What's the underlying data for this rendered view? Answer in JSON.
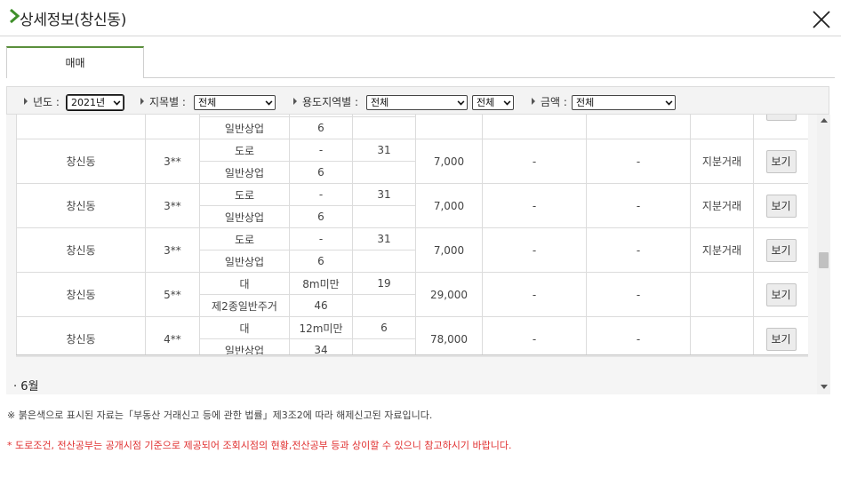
{
  "window": {
    "title": "상세정보(창신동)"
  },
  "tabs": [
    {
      "label": "매매"
    }
  ],
  "filters": {
    "year_label": "년도 :",
    "year_value": "2021년",
    "land_label": "지목별 :",
    "land_value": "전체",
    "zone_label": "용도지역별 :",
    "zone_value": "전체",
    "zone_sub_value": "전체",
    "price_label": "금액 :",
    "price_value": "전체"
  },
  "table": {
    "partial_top": {
      "sub2_label": "일반상업",
      "sub2_value": "6",
      "button": ""
    },
    "rows": [
      {
        "dong": "창신동",
        "lot": "3**",
        "cat1": "도로",
        "val1": "-",
        "num": "31",
        "cat2": "일반상업",
        "val2": "6",
        "price": "7,000",
        "col7": "-",
        "col8": "-",
        "type": "지분거래",
        "button": "보기"
      },
      {
        "dong": "창신동",
        "lot": "3**",
        "cat1": "도로",
        "val1": "-",
        "num": "31",
        "cat2": "일반상업",
        "val2": "6",
        "price": "7,000",
        "col7": "-",
        "col8": "-",
        "type": "지분거래",
        "button": "보기"
      },
      {
        "dong": "창신동",
        "lot": "3**",
        "cat1": "도로",
        "val1": "-",
        "num": "31",
        "cat2": "일반상업",
        "val2": "6",
        "price": "7,000",
        "col7": "-",
        "col8": "-",
        "type": "지분거래",
        "button": "보기"
      },
      {
        "dong": "창신동",
        "lot": "5**",
        "cat1": "대",
        "val1": "8m미만",
        "num": "19",
        "cat2": "제2종일반주거",
        "val2": "46",
        "price": "29,000",
        "col7": "-",
        "col8": "-",
        "type": "",
        "button": "보기"
      },
      {
        "dong": "창신동",
        "lot": "4**",
        "cat1": "대",
        "val1": "12m미만",
        "num": "6",
        "cat2": "일반상업",
        "val2": "34",
        "price": "78,000",
        "col7": "-",
        "col8": "-",
        "type": "",
        "button": "보기"
      }
    ]
  },
  "month_heading": "· 6월",
  "notes": {
    "info": "※ 붉은색으로 표시된 자료는「부동산 거래신고 등에 관한 법률」제3조2에 따라 해제신고된 자료입니다.",
    "warning": "* 도로조건, 전산공부는 공개시점 기준으로 제공되어 조회시점의 현황,전산공부 등과 상이할 수 있으니 참고하시기 바랍니다."
  },
  "colors": {
    "accent_green": "#5a8f3c",
    "warning_red": "#e03030"
  }
}
